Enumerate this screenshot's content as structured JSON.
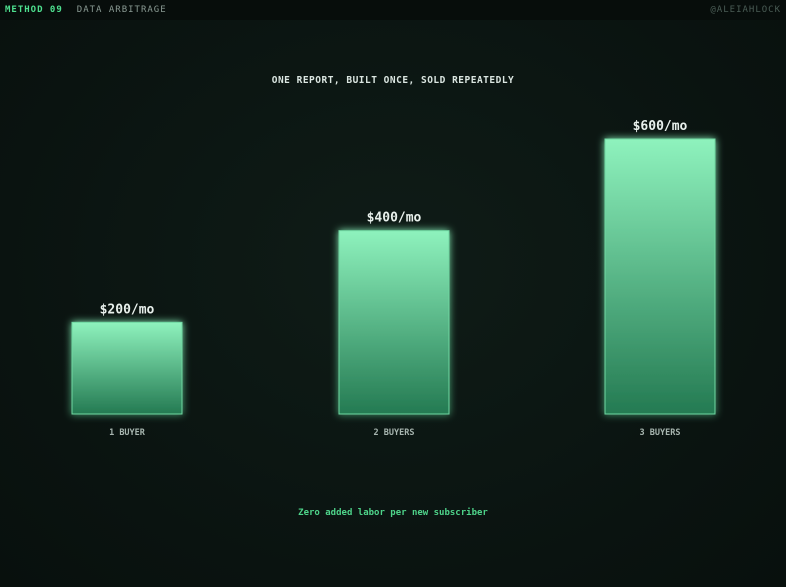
{
  "header": {
    "method": "METHOD 09",
    "section": "DATA ARBITRAGE",
    "handle": "@ALEIAHLOCK"
  },
  "chart_data": {
    "type": "bar",
    "title": "ONE REPORT, BUILT ONCE, SOLD REPEATEDLY",
    "categories": [
      "1 BUYER",
      "2 BUYERS",
      "3 BUYERS"
    ],
    "values": [
      200,
      400,
      600
    ],
    "value_labels": [
      "$200/mo",
      "$400/mo",
      "$600/mo"
    ],
    "unit": "$/mo",
    "ylim": [
      0,
      600
    ],
    "grid": false,
    "legend": "none",
    "colors": {
      "bar_top": "#8ef2bd",
      "bar_bottom": "#247a52",
      "bar_stroke": "#6fd8a2",
      "label": "#e8f0ec",
      "category": "#a7b5af"
    }
  },
  "footnote": "Zero added labor per new subscriber"
}
